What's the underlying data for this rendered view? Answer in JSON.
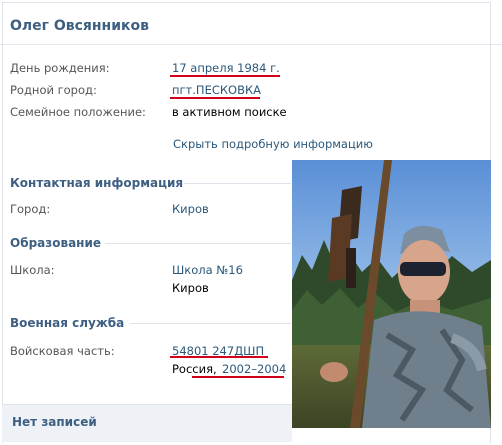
{
  "profile": {
    "name": "Олег Овсянников",
    "birthday_label": "День рождения:",
    "birthday_value": "17 апреля 1984 г.",
    "hometown_label": "Родной город:",
    "hometown_value": "пгт.ПЕСКОВКА",
    "relationship_label": "Семейное положение:",
    "relationship_value": "в активном поиске",
    "toggle_details": "Скрыть подробную информацию"
  },
  "contact": {
    "heading": "Контактная информация",
    "city_label": "Город:",
    "city_value": "Киров"
  },
  "education": {
    "heading": "Образование",
    "school_label": "Школа:",
    "school_value": "Школа №16",
    "school_city": "Киров"
  },
  "military": {
    "heading": "Военная служба",
    "unit_label": "Войсковая часть:",
    "unit_value": "54801 247ДШП",
    "country": "Россия,",
    "years": "2002–2004"
  },
  "wall": {
    "label": "Нет записей"
  },
  "colors": {
    "heading_blue": "#3d5f82",
    "link_blue": "#2b587a",
    "annotation_red": "#d0021b"
  },
  "icons": {
    "photo": "profile-photo"
  }
}
